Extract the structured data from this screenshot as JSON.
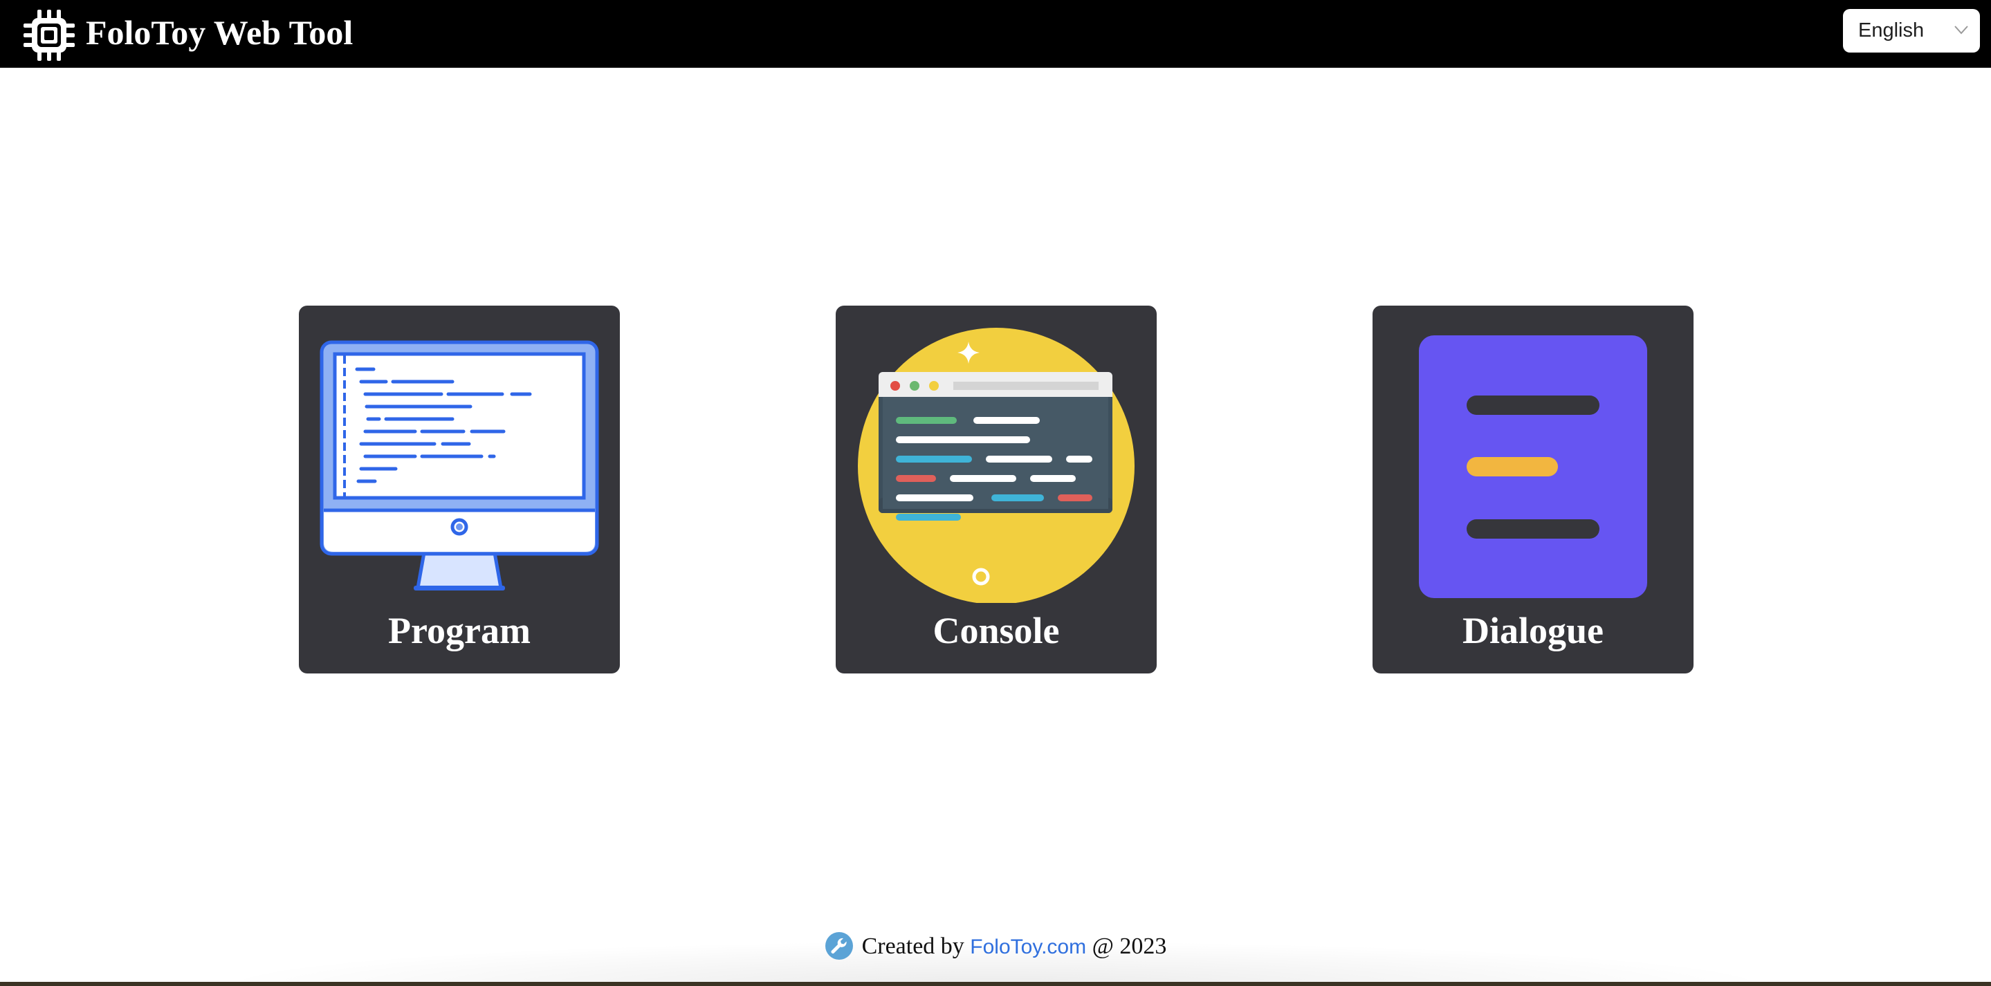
{
  "header": {
    "title": "FoloToy Web Tool",
    "logo_icon": "chip-icon",
    "language_select": {
      "selected": "English",
      "icon": "chevron-down-icon"
    }
  },
  "cards": [
    {
      "label": "Program",
      "icon": "monitor-code-icon"
    },
    {
      "label": "Console",
      "icon": "terminal-window-icon"
    },
    {
      "label": "Dialogue",
      "icon": "document-lines-icon"
    }
  ],
  "footer": {
    "icon": "wrench-icon",
    "prefix": "Created by",
    "link_text": "FoloToy.com",
    "suffix": "@ 2023"
  },
  "colors": {
    "header_bg": "#000000",
    "card_bg": "#36363b",
    "link": "#2f6fde",
    "console_circle": "#f2cf3f",
    "dialogue_doc": "#6655f2"
  }
}
